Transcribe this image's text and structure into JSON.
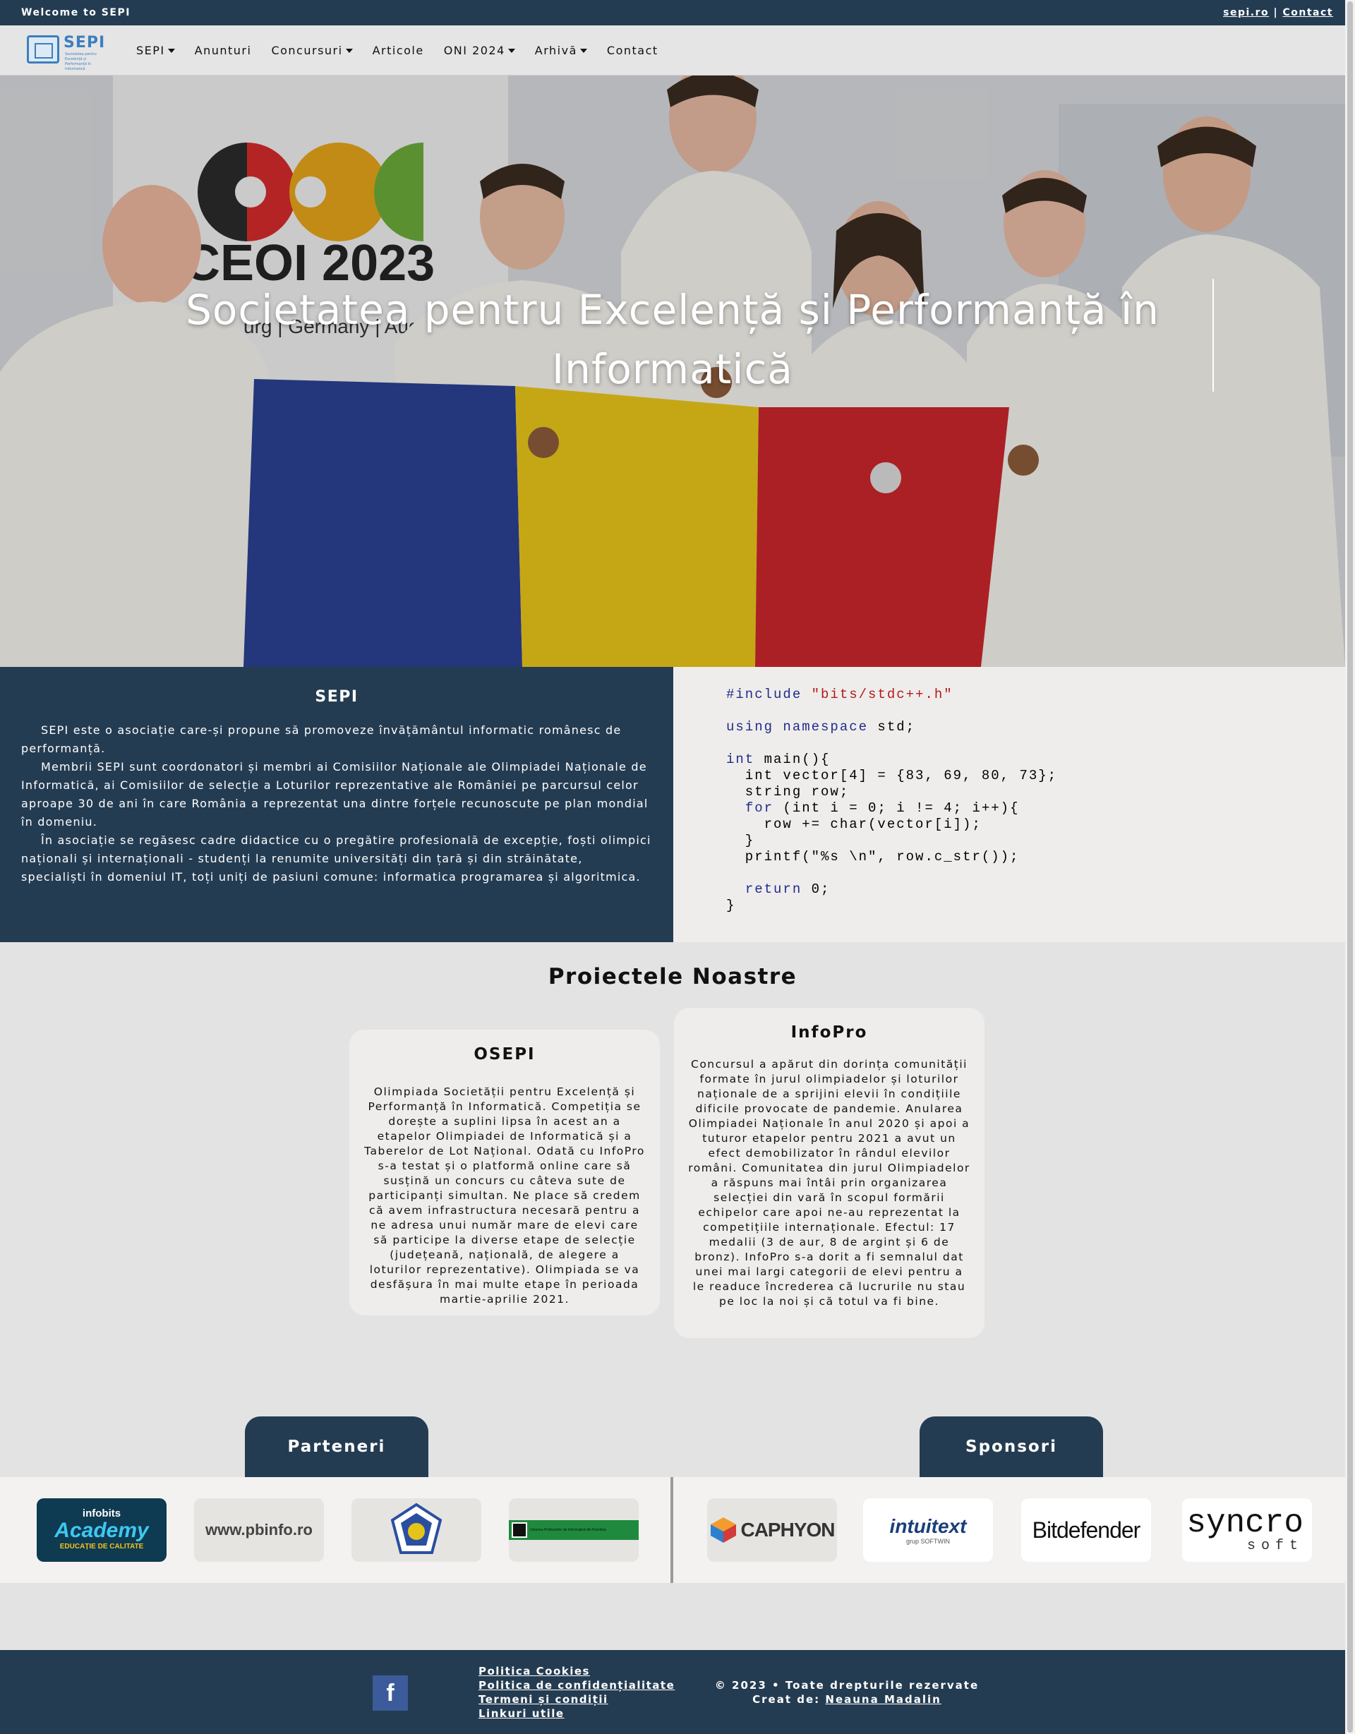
{
  "topbar": {
    "welcome": "Welcome to SEPI",
    "site_link": "sepi.ro",
    "separator": "|",
    "contact_link": "Contact"
  },
  "nav": {
    "logo_text": "SEPI",
    "logo_subtitle": "Societatea pentru Excelență și Performanță în Informatică",
    "items": [
      {
        "label": "SEPI",
        "dropdown": true
      },
      {
        "label": "Anunturi",
        "dropdown": false
      },
      {
        "label": "Concursuri",
        "dropdown": true
      },
      {
        "label": "Articole",
        "dropdown": false
      },
      {
        "label": "ONI 2024",
        "dropdown": true
      },
      {
        "label": "Arhivă",
        "dropdown": true
      },
      {
        "label": "Contact",
        "dropdown": false
      }
    ]
  },
  "hero": {
    "title_line1": "Societatea pentru Excelență și Performanță în",
    "title_line2": "Informatică",
    "banner_text": "CEOI 2023",
    "banner_sub": "urg | Germany | August"
  },
  "about": {
    "heading": "SEPI",
    "paragraphs": [
      "SEPI este o asociație care-și propune să promoveze învățământul informatic românesc de performanță.",
      "Membrii SEPI sunt coordonatori și membri ai Comisiilor Naționale ale Olimpiadei Naționale de Informatică, ai Comisiilor de selecție a Loturilor reprezentative ale României pe parcursul celor aproape 30 de ani în care România a reprezentat una dintre forțele recunoscute pe plan mondial în domeniu.",
      "În asociație se regăsesc cadre didactice cu o pregătire profesională de excepție, foști olimpici naționali și internaționali - studenți la renumite universități din țară și din străinătate, specialiști în domeniul IT, toți uniți de pasiuni comune: informatica programarea și algoritmica."
    ]
  },
  "code": {
    "include_kw": "#include",
    "include_str": "\"bits/stdc++.h\"",
    "using_kw": "using namespace",
    "using_rest": " std;",
    "int_kw": "int",
    "main_rest": " main(){",
    "line_vector": "  int vector[4] = {83, 69, 80, 73};",
    "line_string": "  string row;",
    "for_kw": "for",
    "for_rest": " (int i = 0; i != 4; i++){",
    "line_row": "    row += char(vector[i]);",
    "line_close_inner": "  }",
    "line_printf": "  printf(\"%s \\n\", row.c_str());",
    "return_kw": "return",
    "return_rest": " 0;",
    "line_close": "}"
  },
  "projects": {
    "heading": "Proiectele Noastre",
    "cards": [
      {
        "title": "OSEPI",
        "text": "Olimpiada Societății pentru Excelență și Performanță în Informatică. Competiția se dorește a suplini lipsa în acest an a etapelor Olimpiadei de Informatică și a Taberelor de Lot Național. Odată cu InfoPro s-a testat și o platformă online care să susțină un concurs cu câteva sute de participanți simultan. Ne place să credem că avem infrastructura necesară pentru a ne adresa unui număr mare de elevi care să participe la diverse etape de selecție (județeană, națională, de alegere a loturilor reprezentative). Olimpiada se va desfășura în mai multe etape în perioada martie-aprilie 2021."
      },
      {
        "title": "InfoPro",
        "text": "Concursul a apărut din dorința comunității formate în jurul olimpiadelor și loturilor naționale de a sprijini elevii în condițiile dificile provocate de pandemie. Anularea Olimpiadei Naționale în anul 2020 și apoi a tuturor etapelor pentru 2021 a avut un efect demobilizator în rândul elevilor români. Comunitatea din jurul Olimpiadelor a răspuns mai întâi prin organizarea selecției din vară în scopul formării echipelor care apoi ne-au reprezentat la competițiile internaționale. Efectul: 17 medalii (3 de aur, 8 de argint și 6 de bronz). InfoPro s-a dorit a fi semnalul dat unei mai largi categorii de elevi pentru a le readuce încrederea că lucrurile nu stau pe loc la noi și că totul va fi bine."
      }
    ]
  },
  "partners": {
    "tab_label": "Parteneri",
    "logos": [
      {
        "name": "infobits-academy",
        "line1": "infobits",
        "line2": "Academy",
        "line3": "EDUCAȚIE DE CALITATE"
      },
      {
        "name": "pbinfo",
        "text": "www.pbinfo.ro"
      },
      {
        "name": "university-crest"
      },
      {
        "name": "uniunea-profesorilor",
        "text": "Uniunea Profesorilor de Informatică din România"
      }
    ]
  },
  "sponsors": {
    "tab_label": "Sponsori",
    "logos": [
      {
        "name": "caphyon",
        "text": "CAPHYON"
      },
      {
        "name": "intuitext",
        "text": "intuitext",
        "sub": "grup SOFTWIN"
      },
      {
        "name": "bitdefender",
        "text": "Bitdefender"
      },
      {
        "name": "syncro-soft",
        "text1": "syncro",
        "text2": "soft"
      }
    ]
  },
  "footer": {
    "facebook": "f",
    "links": [
      "Politica Cookies",
      "Politica de confidențialitate",
      "Termeni și condiții",
      "Linkuri utile"
    ],
    "copyright": "© 2023 • Toate drepturile rezervate",
    "created_prefix": "Creat de:",
    "created_by": "Neauna Madalin"
  },
  "colors": {
    "brand_dark": "#243c52",
    "code_keyword": "#1f2c8c",
    "code_string": "#b21a1a",
    "flag_blue": "#2a3f91",
    "flag_yellow": "#e6c31a",
    "flag_red": "#c8262a"
  }
}
